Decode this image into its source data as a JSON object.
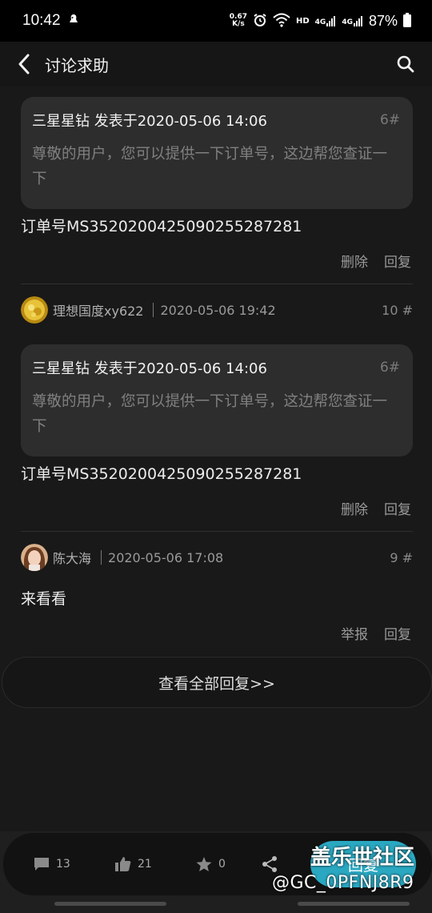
{
  "status_bar": {
    "time": "10:42",
    "speed_value": "0.67",
    "speed_unit": "K/s",
    "hd": "HD",
    "net1": "4G",
    "net2": "4G",
    "battery": "87%"
  },
  "header": {
    "title": "讨论求助"
  },
  "posts": [
    {
      "quote": {
        "author_line": "三星星钻 发表于2020-05-06 14:06",
        "floor": "6#",
        "body": "尊敬的用户，您可以提供一下订单号，这边帮您查证一下"
      },
      "text": "订单号MS352020042509025528728 1",
      "actions": [
        "删除",
        "回复"
      ]
    }
  ],
  "post_a": {
    "quote_author_line": "三星星钻 发表于2020-05-06 14:06",
    "quote_floor": "6#",
    "quote_body": "尊敬的用户，您可以提供一下订单号，这边帮您查证一下",
    "text": "订单号MS3520200425090255287281",
    "delete": "删除",
    "reply": "回复"
  },
  "post_b": {
    "author": "理想国度xy622",
    "time": "2020-05-06 19:42",
    "floor": "10 #",
    "quote_author_line": "三星星钻 发表于2020-05-06 14:06",
    "quote_floor": "6#",
    "quote_body": "尊敬的用户，您可以提供一下订单号，这边帮您查证一下",
    "text": "订单号MS3520200425090255287281",
    "delete": "删除",
    "reply": "回复"
  },
  "post_c": {
    "author": "陈大海",
    "time": "2020-05-06 17:08",
    "floor": "9 #",
    "text": "来看看",
    "report": "举报",
    "reply": "回复"
  },
  "view_all": "查看全部回复>>",
  "bottom_bar": {
    "comments": "13",
    "likes": "21",
    "favorites": "0",
    "reply_label": "回复"
  },
  "watermark": {
    "line1": "盖乐世社区",
    "line2": "@GC_0PFNJ8R9"
  },
  "colors": {
    "accent": "#2aa8c2",
    "background": "#191919",
    "card": "#2d2d2d"
  }
}
